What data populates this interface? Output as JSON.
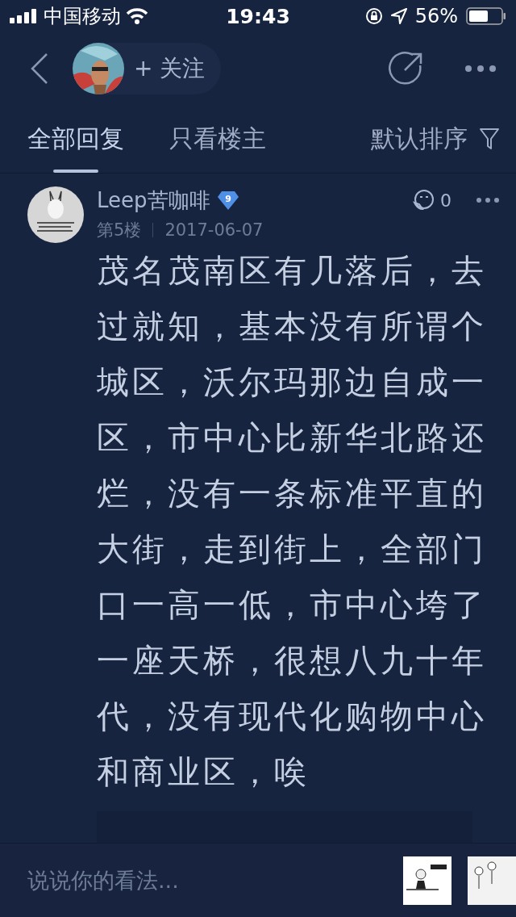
{
  "status_bar": {
    "carrier": "中国移动",
    "time": "19:43",
    "battery": "56%"
  },
  "nav": {
    "follow_label": "+ 关注"
  },
  "tabs": [
    {
      "label": "全部回复",
      "selected": true
    },
    {
      "label": "只看楼主",
      "selected": false
    }
  ],
  "sort": {
    "label": "默认排序"
  },
  "comment": {
    "author": "Leep苦咖啡",
    "level_badge": "9",
    "floor": "第5楼",
    "date": "2017-06-07",
    "likes": "0",
    "text": "茂名茂南区有几落后，去过就知，基本没有所谓个城区，沃尔玛那边自成一区，市中心比新华北路还烂，没有一条标准平直的大街，走到街上，全部门口一高一低，市中心垮了一座天桥，很想八九十年代，没有现代化购物中心和商业区，唉"
  },
  "input": {
    "placeholder": "说说你的看法..."
  }
}
